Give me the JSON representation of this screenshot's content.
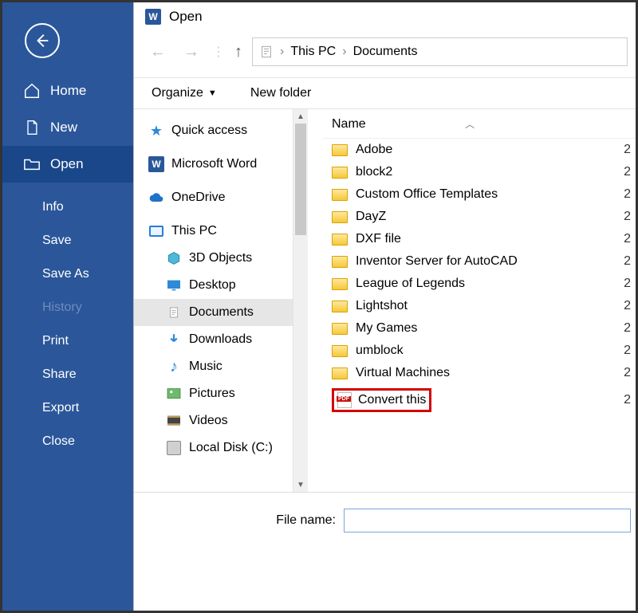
{
  "backstage": {
    "items": [
      {
        "label": "Home",
        "icon": "home"
      },
      {
        "label": "New",
        "icon": "file"
      },
      {
        "label": "Open",
        "icon": "folder",
        "selected": true
      }
    ],
    "subs": [
      {
        "label": "Info"
      },
      {
        "label": "Save"
      },
      {
        "label": "Save As"
      },
      {
        "label": "History",
        "disabled": true
      },
      {
        "label": "Print"
      },
      {
        "label": "Share"
      },
      {
        "label": "Export"
      },
      {
        "label": "Close"
      }
    ]
  },
  "dialog": {
    "title": "Open",
    "nav": {
      "back_disabled": true,
      "fwd_disabled": true
    },
    "breadcrumb": [
      "This PC",
      "Documents"
    ],
    "toolbar": {
      "organize": "Organize",
      "newfolder": "New folder"
    },
    "list_header": {
      "name": "Name"
    },
    "navpane": [
      {
        "label": "Quick access",
        "icon": "star"
      },
      {
        "label": "Microsoft Word",
        "icon": "word"
      },
      {
        "label": "OneDrive",
        "icon": "cloud"
      },
      {
        "label": "This PC",
        "icon": "pc"
      },
      {
        "label": "3D Objects",
        "icon": "cube",
        "child": true
      },
      {
        "label": "Desktop",
        "icon": "desktop",
        "child": true
      },
      {
        "label": "Documents",
        "icon": "doc",
        "child": true,
        "selected": true
      },
      {
        "label": "Downloads",
        "icon": "download",
        "child": true
      },
      {
        "label": "Music",
        "icon": "music",
        "child": true
      },
      {
        "label": "Pictures",
        "icon": "pictures",
        "child": true
      },
      {
        "label": "Videos",
        "icon": "videos",
        "child": true
      },
      {
        "label": "Local Disk (C:)",
        "icon": "disk",
        "child": true
      }
    ],
    "files": [
      {
        "name": "Adobe",
        "type": "folder"
      },
      {
        "name": "block2",
        "type": "folder"
      },
      {
        "name": "Custom Office Templates",
        "type": "folder"
      },
      {
        "name": "DayZ",
        "type": "folder"
      },
      {
        "name": "DXF file",
        "type": "folder"
      },
      {
        "name": "Inventor Server for AutoCAD",
        "type": "folder"
      },
      {
        "name": "League of Legends",
        "type": "folder"
      },
      {
        "name": "Lightshot",
        "type": "folder"
      },
      {
        "name": "My Games",
        "type": "folder"
      },
      {
        "name": "umblock",
        "type": "folder"
      },
      {
        "name": "Virtual Machines",
        "type": "folder"
      },
      {
        "name": "Convert this",
        "type": "pdf",
        "highlight": true
      }
    ],
    "filename": {
      "label": "File name:",
      "value": ""
    }
  }
}
